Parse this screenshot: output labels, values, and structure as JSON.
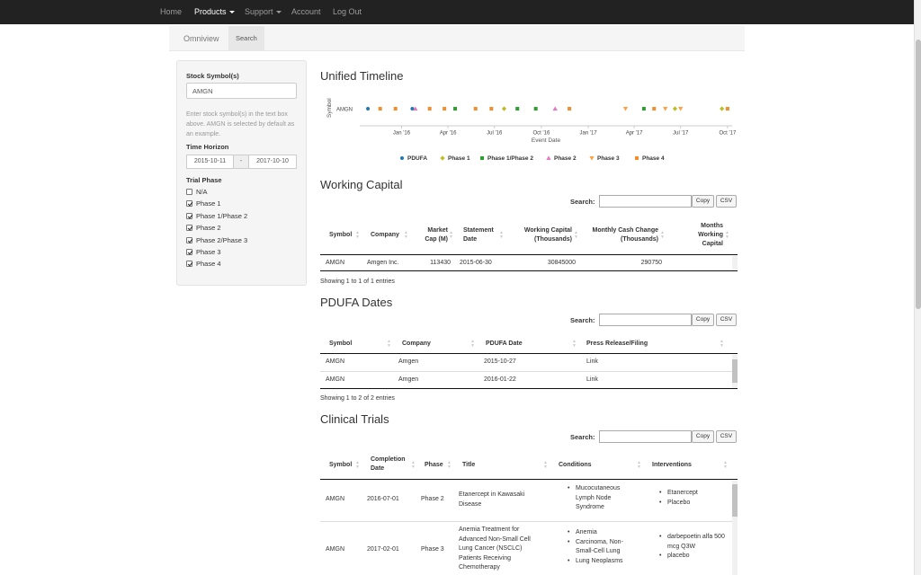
{
  "navbar": {
    "items": [
      "Home",
      "Products",
      "Support",
      "Account",
      "Log Out"
    ]
  },
  "tabs": [
    "Omniview",
    "Search"
  ],
  "sidebar": {
    "stock_label": "Stock Symbol(s)",
    "stock_value": "AMGN",
    "help_text": "Enter stock symbol(s) in the text box above. AMGN is selected by default as an example.",
    "time_label": "Time Horizon",
    "date_start": "2015-10-11",
    "date_sep": "-",
    "date_end": "2017-10-10",
    "trial_label": "Trial Phase",
    "phases": [
      {
        "label": "N/A",
        "checked": false
      },
      {
        "label": "Phase 1",
        "checked": true
      },
      {
        "label": "Phase 1/Phase 2",
        "checked": true
      },
      {
        "label": "Phase 2",
        "checked": true
      },
      {
        "label": "Phase 2/Phase 3",
        "checked": true
      },
      {
        "label": "Phase 3",
        "checked": true
      },
      {
        "label": "Phase 4",
        "checked": true
      }
    ]
  },
  "timeline": {
    "title": "Unified Timeline",
    "chart_data": {
      "type": "scatter",
      "y_categories": [
        "AMGN"
      ],
      "ylabel": "Symbol",
      "xlabel": "Event Date",
      "x_ticks": [
        "Jan '16",
        "Apr '16",
        "Jul '16",
        "Oct '16",
        "Jan '17",
        "Apr '17",
        "Jul '17",
        "Oct '17"
      ],
      "x_tick_dates": [
        "2016-01-01",
        "2016-04-01",
        "2016-07-01",
        "2016-10-01",
        "2017-01-01",
        "2017-04-01",
        "2017-07-01",
        "2017-10-01"
      ],
      "xlim": [
        "2015-10-11",
        "2017-10-10"
      ],
      "legend_position": "bottom",
      "series": [
        {
          "name": "PDUFA",
          "color": "#1f77b4",
          "shape": "circle",
          "points": [
            {
              "x": "2015-10-27",
              "y": "AMGN"
            },
            {
              "x": "2016-01-22",
              "y": "AMGN"
            }
          ]
        },
        {
          "name": "Phase 1",
          "color": "#bcbd22",
          "shape": "diamond",
          "points": [
            {
              "x": "2016-07-20",
              "y": "AMGN"
            },
            {
              "x": "2017-06-20",
              "y": "AMGN"
            },
            {
              "x": "2017-09-20",
              "y": "AMGN"
            }
          ]
        },
        {
          "name": "Phase 1/Phase 2",
          "color": "#2ca02c",
          "shape": "square",
          "points": [
            {
              "x": "2016-04-15",
              "y": "AMGN"
            },
            {
              "x": "2016-08-15",
              "y": "AMGN"
            },
            {
              "x": "2016-09-20",
              "y": "AMGN"
            },
            {
              "x": "2017-04-20",
              "y": "AMGN"
            }
          ]
        },
        {
          "name": "Phase 2",
          "color": "#e377c2",
          "shape": "triangle-up",
          "points": [
            {
              "x": "2016-01-28",
              "y": "AMGN"
            },
            {
              "x": "2016-10-28",
              "y": "AMGN"
            }
          ]
        },
        {
          "name": "Phase 3",
          "color": "#ff9f40",
          "shape": "triangle-down",
          "points": [
            {
              "x": "2017-03-15",
              "y": "AMGN"
            },
            {
              "x": "2017-06-01",
              "y": "AMGN"
            },
            {
              "x": "2017-07-01",
              "y": "AMGN"
            }
          ]
        },
        {
          "name": "Phase 4",
          "color": "#f28e2b",
          "shape": "square",
          "points": [
            {
              "x": "2015-11-20",
              "y": "AMGN"
            },
            {
              "x": "2015-12-20",
              "y": "AMGN"
            },
            {
              "x": "2016-02-25",
              "y": "AMGN"
            },
            {
              "x": "2016-03-25",
              "y": "AMGN"
            },
            {
              "x": "2016-05-25",
              "y": "AMGN"
            },
            {
              "x": "2016-06-25",
              "y": "AMGN"
            },
            {
              "x": "2016-11-25",
              "y": "AMGN"
            },
            {
              "x": "2017-05-10",
              "y": "AMGN"
            },
            {
              "x": "2017-10-01",
              "y": "AMGN"
            }
          ]
        }
      ]
    }
  },
  "working_capital": {
    "title": "Working Capital",
    "search_label": "Search:",
    "copy_label": "Copy",
    "csv_label": "CSV",
    "headers": [
      "Symbol",
      "Company",
      "Market Cap (M)",
      "Statement Date",
      "Working Capital (Thousands)",
      "Monthly Cash Change (Thousands)",
      "Months Working Capital"
    ],
    "rows": [
      {
        "symbol": "AMGN",
        "company": "Amgen Inc.",
        "market_cap": "113430",
        "statement_date": "2015-06-30",
        "working_capital": "30845000",
        "cash_change": "290750",
        "months": ""
      }
    ],
    "showing": "Showing 1 to 1 of 1 entries"
  },
  "pdufa": {
    "title": "PDUFA Dates",
    "search_label": "Search:",
    "copy_label": "Copy",
    "csv_label": "CSV",
    "headers": [
      "Symbol",
      "Company",
      "PDUFA Date",
      "Press Release/Filing"
    ],
    "rows": [
      {
        "symbol": "AMGN",
        "company": "Amgen",
        "date": "2015-10-27",
        "link": "Link"
      },
      {
        "symbol": "AMGN",
        "company": "Amgen",
        "date": "2016-01-22",
        "link": "Link"
      }
    ],
    "showing": "Showing 1 to 2 of 2 entries"
  },
  "clinical": {
    "title": "Clinical Trials",
    "search_label": "Search:",
    "copy_label": "Copy",
    "csv_label": "CSV",
    "headers": [
      "Symbol",
      "Completion Date",
      "Phase",
      "Title",
      "Conditions",
      "Interventions"
    ],
    "rows": [
      {
        "symbol": "AMGN",
        "date": "2016-07-01",
        "phase": "Phase 2",
        "title": "Etanercept in Kawasaki Disease",
        "conditions": [
          "Mucocutaneous Lymph Node Syndrome"
        ],
        "interventions": [
          "Etanercept",
          "Placebo"
        ]
      },
      {
        "symbol": "AMGN",
        "date": "2017-02-01",
        "phase": "Phase 3",
        "title": "Anemia Treatment for Advanced Non-Small Cell Lung Cancer (NSCLC) Patients Receiving Chemotherapy",
        "conditions": [
          "Anemia",
          "Carcinoma, Non-Small-Cell Lung",
          "Lung Neoplasms"
        ],
        "interventions": [
          "darbepoetin alfa 500 mcg Q3W",
          "placebo"
        ]
      }
    ]
  }
}
